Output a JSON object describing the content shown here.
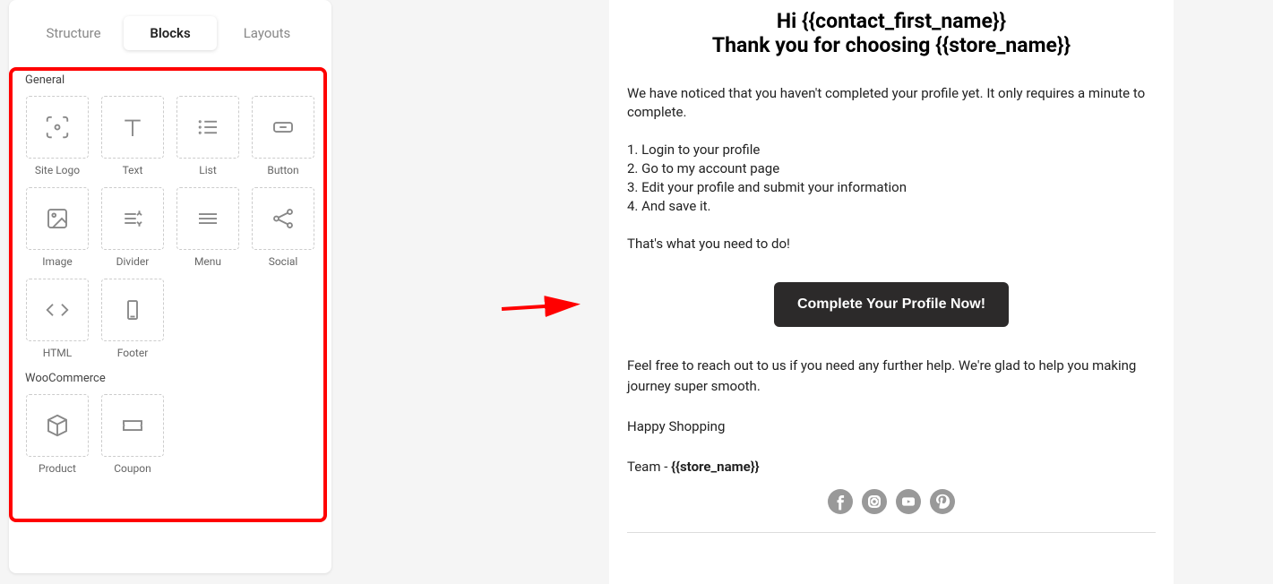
{
  "tabs": {
    "structure": "Structure",
    "blocks": "Blocks",
    "layouts": "Layouts"
  },
  "sections": {
    "general": "General",
    "woocommerce": "WooCommerce"
  },
  "blocks": {
    "siteLogo": "Site Logo",
    "text": "Text",
    "list": "List",
    "button": "Button",
    "image": "Image",
    "divider": "Divider",
    "menu": "Menu",
    "social": "Social",
    "html": "HTML",
    "footer": "Footer",
    "product": "Product",
    "coupon": "Coupon"
  },
  "email": {
    "hi": "Hi {{contact_first_name}}",
    "thank": "Thank you for choosing {{store_name}}",
    "noticed": "We have noticed that you haven't completed your profile yet. It only requires a minute to complete.",
    "step1": "1. Login to your profile",
    "step2": "2. Go to my account page",
    "step3": "3. Edit your profile and submit your information",
    "step4": "4. And save it.",
    "thatswhat": "That's what you need to do!",
    "cta": "Complete Your Profile Now!",
    "feelfree": "Feel free to reach out to us if you need any further help. We're glad to help you making journey super smooth.",
    "happy": "Happy Shopping",
    "teamPrefix": "Team - ",
    "teamStore": "{{store_name}}"
  }
}
